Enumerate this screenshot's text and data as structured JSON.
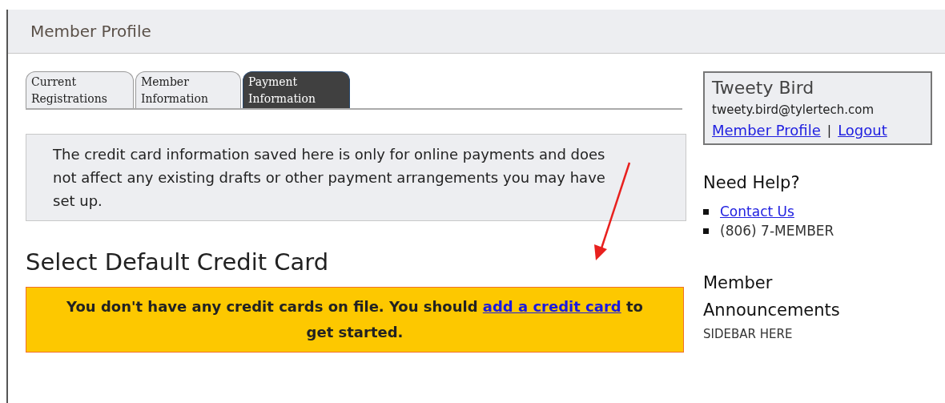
{
  "header": {
    "title": "Member Profile"
  },
  "tabs": [
    {
      "label": "Current Registrations",
      "selected": false
    },
    {
      "label": "Member Information",
      "selected": false
    },
    {
      "label": "Payment Information",
      "selected": true
    }
  ],
  "info_note": "The credit card information saved here is only for online payments and does not affect any existing drafts or other payment arrangements you may have set up.",
  "section_title": "Select Default Credit Card",
  "notice": {
    "before": "You don't have any credit cards on file. You should ",
    "link": "add a credit card",
    "after": " to get started."
  },
  "user_box": {
    "name": "Tweety Bird",
    "email": "tweety.bird@tylertech.com",
    "links": [
      "Member Profile",
      "Logout"
    ],
    "separator": "|"
  },
  "help": {
    "title": "Need Help?",
    "items": [
      {
        "kind": "link",
        "text": "Contact Us"
      },
      {
        "kind": "text",
        "text": "(806) 7-MEMBER"
      }
    ]
  },
  "announcements": {
    "title": "Member Announcements",
    "body": "SIDEBAR HERE"
  }
}
